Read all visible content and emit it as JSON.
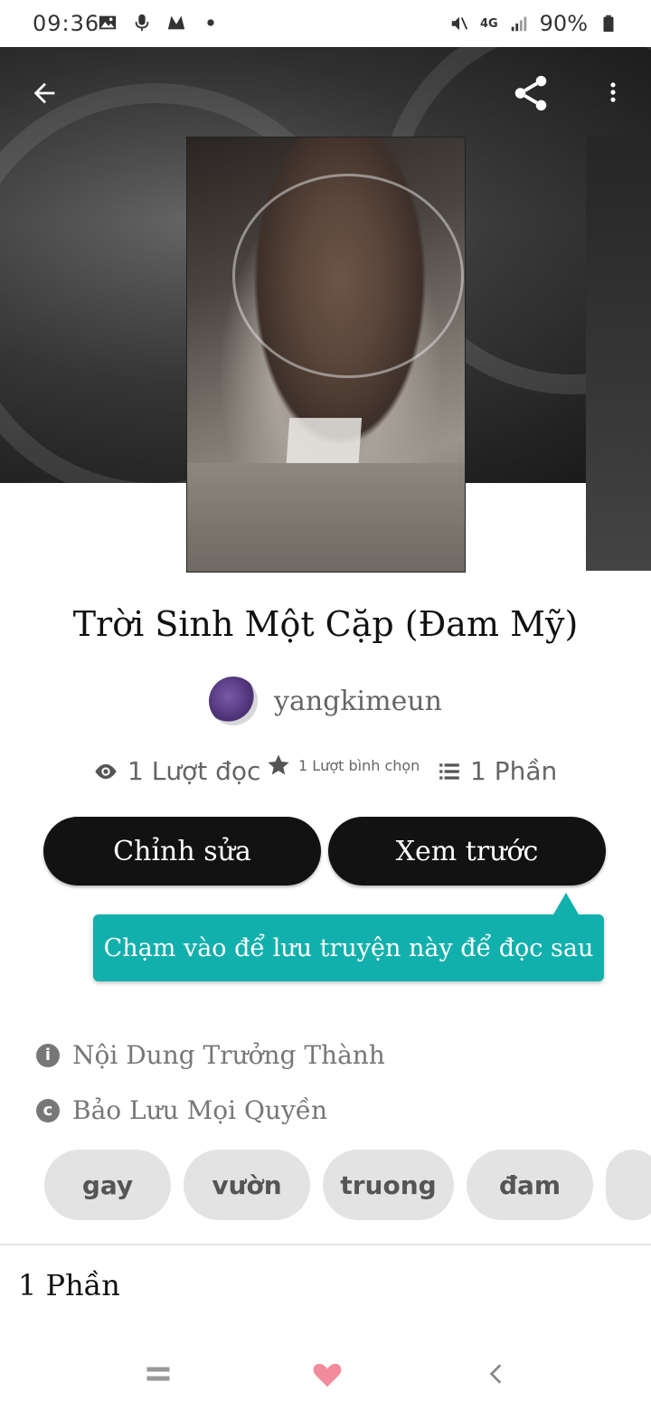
{
  "status_bar": {
    "time": "09:36",
    "battery": "90%",
    "network": "4G"
  },
  "story": {
    "title": "Trời Sinh Một Cặp (Đam Mỹ)",
    "author": "yangkimeun",
    "reads": "1 Lượt đọc",
    "votes": "1 Lượt bình chọn",
    "parts": "1 Phần"
  },
  "buttons": {
    "edit": "Chỉnh sửa",
    "preview": "Xem trước"
  },
  "tooltip": "Chạm vào để lưu truyện này để đọc sau",
  "info": {
    "mature": "Nội Dung Trưởng Thành",
    "copyright": "Bảo Lưu Mọi Quyền"
  },
  "tags": [
    "gay",
    "vườn",
    "truong",
    "đam"
  ],
  "parts_heading": "1 Phần",
  "colors": {
    "accent": "#12b0ac",
    "button_bg": "#121212",
    "tag_bg": "#e3e3e3"
  },
  "icons": [
    "back-arrow-icon",
    "share-icon",
    "more-vert-icon",
    "eye-icon",
    "star-icon",
    "list-icon",
    "info-icon",
    "copyright-icon",
    "recents-icon",
    "heart-home-icon",
    "back-chevron-icon"
  ]
}
